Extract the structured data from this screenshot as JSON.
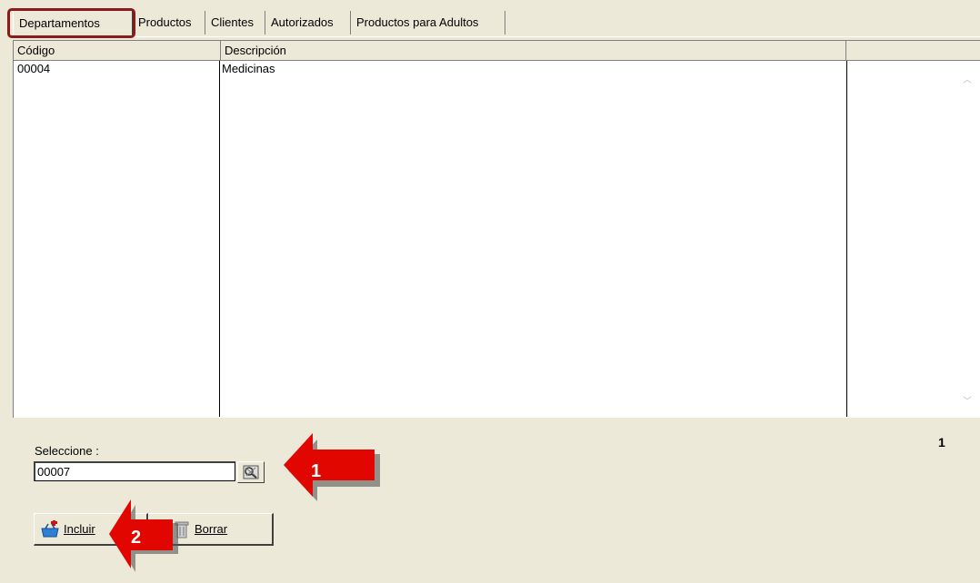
{
  "tabs": [
    {
      "label": "Departamentos",
      "active": true
    },
    {
      "label": "Productos",
      "active": false
    },
    {
      "label": "Clientes",
      "active": false
    },
    {
      "label": "Autorizados",
      "active": false
    },
    {
      "label": "Productos para Adultos",
      "active": false
    }
  ],
  "grid": {
    "columns": [
      "Código",
      "Descripción",
      ""
    ],
    "rows": [
      {
        "codigo": "00004",
        "descripcion": "Medicinas"
      }
    ]
  },
  "counter": "1",
  "selector": {
    "label": "Seleccione :",
    "value": "00007"
  },
  "buttons": {
    "incluir": "Incluir",
    "borrar": "Borrar"
  },
  "callouts": {
    "one": "1",
    "two": "2"
  },
  "colors": {
    "window_bg": "#ece9d8",
    "highlight": "#8b1a1a",
    "arrow": "#e10600"
  }
}
